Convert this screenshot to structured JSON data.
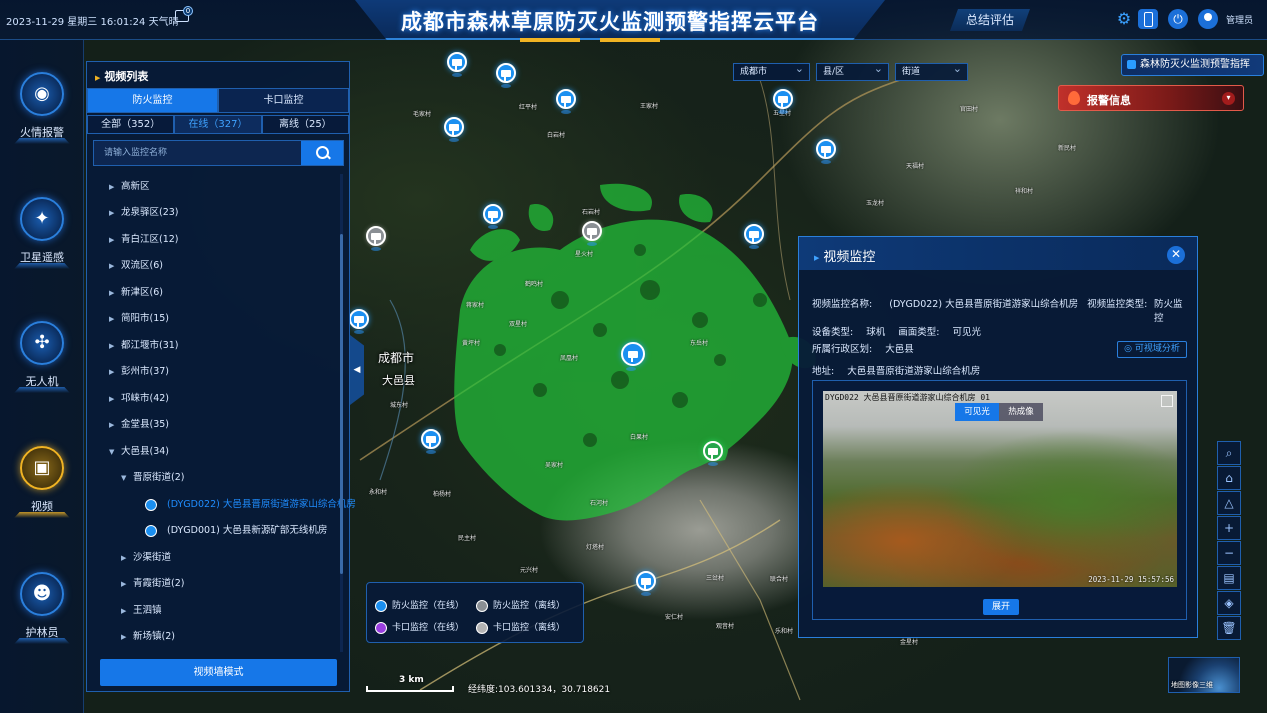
{
  "header": {
    "datetime": "2023-11-29 星期三 16:01:24 天气晴",
    "message_count": "0",
    "title": "成都市森林草原防灭火监测预警指挥云平台",
    "summary_tab": "总结评估",
    "username": "管理员"
  },
  "nav": [
    {
      "label": "火情报警",
      "icon": "alarm-light-icon"
    },
    {
      "label": "卫星遥感",
      "icon": "satellite-icon"
    },
    {
      "label": "无人机",
      "icon": "drone-icon"
    },
    {
      "label": "视频",
      "icon": "camera-icon",
      "active": true
    },
    {
      "label": "护林员",
      "icon": "ranger-icon"
    }
  ],
  "list_panel": {
    "title": "视频列表",
    "tabs": [
      "防火监控",
      "卡口监控"
    ],
    "subtabs": [
      "全部（352）",
      "在线（327）",
      "离线（25）"
    ],
    "search_placeholder": "请输入监控名称",
    "tree": [
      "高新区",
      "龙泉驿区(23)",
      "青白江区(12)",
      "双流区(6)",
      "新津区(6)",
      "简阳市(15)",
      "都江堰市(31)",
      "彭州市(37)",
      "邛崃市(42)",
      "金堂县(35)",
      "大邑县(34)",
      "晋原街道(2)",
      "(DYGD022) 大邑县晋原街道游家山综合机房",
      "(DYGD001) 大邑县新源矿部无线机房",
      "沙渠街道",
      "青霞街道(2)",
      "王泗镇",
      "新场镇(2)"
    ],
    "wall_button": "视频墙模式"
  },
  "filters": {
    "city": "成都市",
    "county": "县/区",
    "street": "街道"
  },
  "warning_dropdown": "森林防灭火监测预警指挥",
  "alarm": {
    "label": "报警信息"
  },
  "map": {
    "city_label": "成都市",
    "county_label": "大邑县",
    "villages": [
      "毛家村",
      "红平村",
      "白岩村",
      "王家村",
      "石岩村",
      "星火村",
      "鹤鸣村",
      "蒋家村",
      "双星村",
      "黄坪村",
      "凤凰村",
      "东岳村",
      "白果村",
      "城东村",
      "吴家村",
      "柏杨村",
      "永和村",
      "石河村",
      "灯塔村",
      "民主村",
      "元兴村",
      "三岔村",
      "联合村",
      "安仁村",
      "观音村",
      "乐和村",
      "金星村",
      "官田村",
      "新民村",
      "天福村",
      "祥和村",
      "玉龙村",
      "五星村"
    ],
    "scale": "3 km",
    "coords": "经纬度:103.601334，30.718621",
    "thumbnail_label": "地图影像三维"
  },
  "popup": {
    "title": "视频监控",
    "name_label": "视频监控名称:",
    "name_value": "(DYGD022) 大邑县晋原街道游家山综合机房",
    "type_label": "视频监控类型:",
    "type_value": "防火监控",
    "device_label": "设备类型:",
    "device_value": "球机",
    "picture_label": "画面类型:",
    "picture_value": "可见光",
    "region_label": "所属行政区划:",
    "region_value": "大邑县",
    "address_label": "地址:",
    "address_value": "大邑县晋原街道游家山综合机房",
    "viz_button": "可视域分析",
    "cam_overlay": "DYGD022 大邑县晋原街道游家山综合机房 01",
    "cam_time": "2023-11-29 15:57:56",
    "modes": [
      "可见光",
      "热成像"
    ],
    "expand_button": "展开"
  },
  "legend": [
    {
      "label": "防火监控（在线）",
      "color": "#1b8ff0"
    },
    {
      "label": "防火监控（离线）",
      "color": "#8a8f94"
    },
    {
      "label": "卡口监控（在线）",
      "color": "#9a3fe0"
    },
    {
      "label": "卡口监控（离线）",
      "color": "#b4b4b4"
    }
  ],
  "colors": {
    "accent": "#1677e8",
    "alarm": "#c0302a",
    "gold": "#f0b323",
    "fire_zone": "#22c23a"
  }
}
